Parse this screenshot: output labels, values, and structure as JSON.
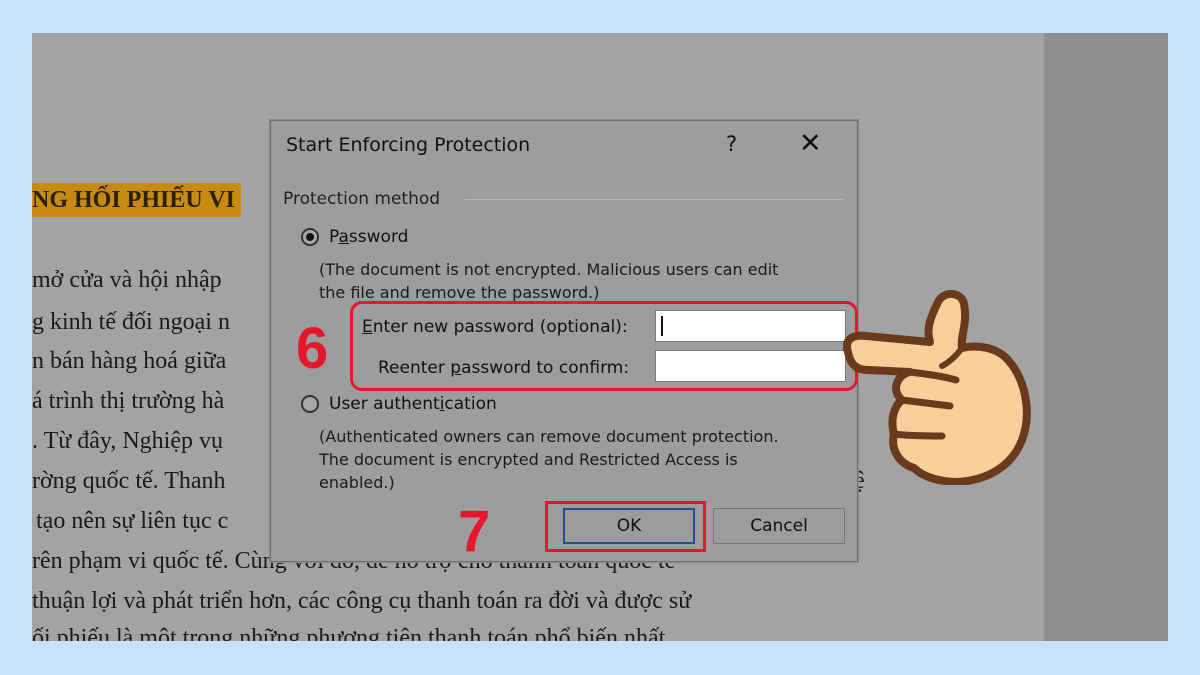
{
  "document": {
    "heading": "NG HỐI PHIẾU VI",
    "lines": [
      "mở cửa và hội nhập",
      "g kinh tế đối ngoại n",
      "n bán hàng hoá giữa",
      "á trình thị trường hà",
      ". Từ đây, Nghiệp vụ",
      "rờng quốc tế. Thanh",
      "tạo nên sự liên tục c",
      "rên phạm vi quốc tế. Cùng với đó, để hỗ trợ cho thanh toán quốc tế",
      "thuận lợi và phát triển hơn, các công cụ thanh toán ra đời và được sử",
      "ối phiếu là một trong những phương tiện thanh toán phổ biến nhất"
    ],
    "right_edge_text": "ệ"
  },
  "dialog": {
    "title": "Start Enforcing Protection",
    "help_label": "?",
    "close_label": "✕",
    "group_label": "Protection method",
    "password_option": {
      "label_pre": "P",
      "label_underlined": "a",
      "label_post": "ssword",
      "selected": true,
      "description_lines": [
        "(The document is not encrypted. Malicious users can edit",
        "the file and remove the password.)"
      ]
    },
    "new_password": {
      "label_underlined": "E",
      "label_post": "nter new password (optional):",
      "value": ""
    },
    "reenter_password": {
      "label_pre": "Reenter ",
      "label_underlined": "p",
      "label_post": "assword to confirm:",
      "value": ""
    },
    "user_auth_option": {
      "label_pre": "User authent",
      "label_underlined": "i",
      "label_post": "cation",
      "selected": false,
      "description_lines": [
        "(Authenticated owners can remove document protection.",
        "The document is encrypted and Restricted Access is",
        "enabled.)"
      ]
    },
    "ok_label": "OK",
    "cancel_label": "Cancel"
  },
  "annotations": {
    "step_6": "6",
    "step_7": "7",
    "highlight_color": "#e6162d"
  },
  "icons": {
    "pointer": "pointing-hand-icon"
  }
}
